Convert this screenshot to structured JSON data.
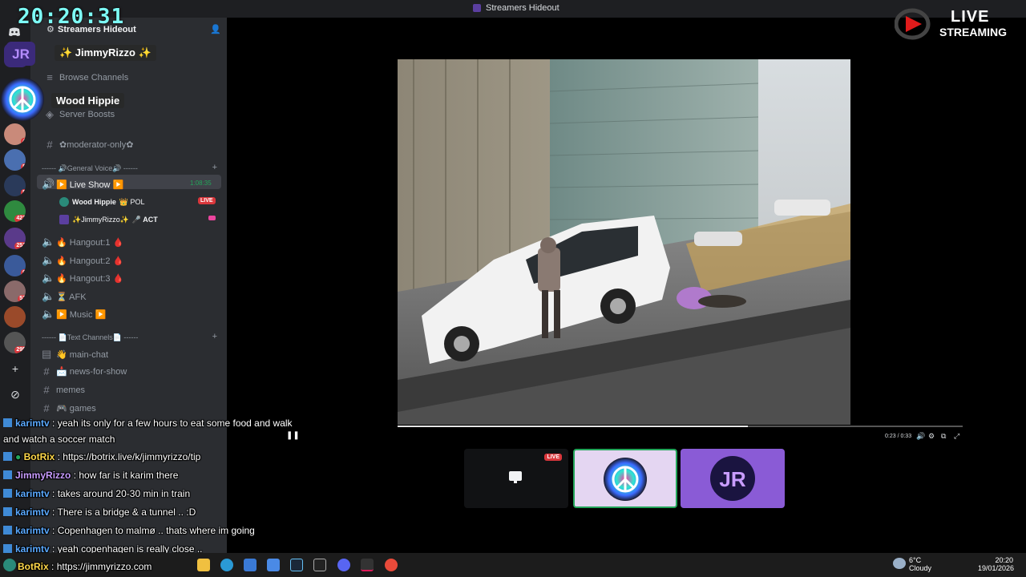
{
  "window": {
    "title": "Streamers Hideout"
  },
  "overlay": {
    "clock": "20:20:31",
    "host_name": "✨ JimmyRizzo ✨",
    "guest_name": "Wood Hippie",
    "live_logo_line1": "LIVE",
    "live_logo_line2": "STREAMING"
  },
  "server_badges": [
    "4",
    "5",
    "5",
    "421",
    "251",
    "9",
    "52",
    "295"
  ],
  "guild": {
    "name": "Streamers Hideout",
    "browse_channels": "Browse Channels",
    "server_boosts": "Server Boosts",
    "moderator_only": "✿moderator-only✿",
    "voice_category": "------ 🔊General Voice🔊 ------",
    "live_show": "▶️ Live Show ▶️",
    "live_show_timer": "1:08:35",
    "voice_users": [
      {
        "name": "Wood Hippie",
        "tag": "👑 POL",
        "status": "LIVE"
      },
      {
        "name": "✨JimmyRizzo✨",
        "tag": "🎤 ACT",
        "status": ""
      }
    ],
    "voice_channels": [
      "🔥 Hangout:1 🩸",
      "🔥 Hangout:2 🩸",
      "🔥 Hangout:3 🩸",
      "⏳ AFK",
      "▶️ Music ▶️"
    ],
    "text_category": "------ 📄Text Channels📄 ------",
    "text_channels": [
      "👋 main-chat",
      "📩 news-for-show",
      "memes",
      "🎮 games"
    ]
  },
  "video": {
    "timecode": "0:23 / 0:33",
    "progress": 0.62
  },
  "tiles": {
    "live_label": "LIVE"
  },
  "chat": [
    {
      "user": "karimtv",
      "text": "yeah its only for a few hours to eat some food and walk"
    },
    {
      "user": "",
      "text": "and watch a soccer match"
    },
    {
      "user": "BotRix",
      "text": "https://botrix.live/k/jimmyrizzo/tip"
    },
    {
      "user": "JimmyRizzo",
      "text": "how far is it karim there"
    },
    {
      "user": "karimtv",
      "text": "takes around 20-30 min in train"
    },
    {
      "user": "karimtv",
      "text": "There is a bridge & a tunnel .. :D"
    },
    {
      "user": "karimtv",
      "text": "Copenhagen to malmø .. thats where im going"
    },
    {
      "user": "karimtv",
      "text": "yeah copenhagen is really close .."
    },
    {
      "user": "BotRix",
      "text": "https://jimmyrizzo.com"
    }
  ],
  "taskbar": {
    "temperature": "6°C",
    "condition": "Cloudy",
    "time": "20:20",
    "date": "19/01/2026"
  },
  "colors": {
    "accent": "#5865f2",
    "live": "#da373c",
    "clock": "#7dfcf6",
    "chat_user": "#5aa9ff"
  }
}
